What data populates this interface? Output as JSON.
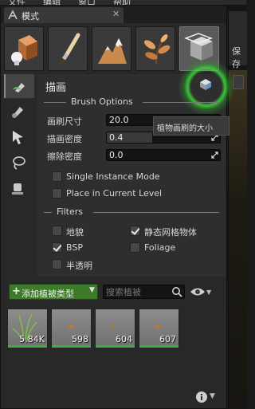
{
  "menubar": {
    "items": [
      "文件",
      "编辑",
      "窗口",
      "帮助"
    ]
  },
  "tab": {
    "label": "模式",
    "close": "✕"
  },
  "modes": [
    {
      "name": "place"
    },
    {
      "name": "paint"
    },
    {
      "name": "landscape"
    },
    {
      "name": "foliage"
    },
    {
      "name": "geometry"
    }
  ],
  "tools": [
    "paint",
    "reapply",
    "select",
    "lasso",
    "fill"
  ],
  "panel": {
    "title": "描画",
    "brush_options": "Brush Options",
    "brush_size_label": "画刷尺寸",
    "brush_size": "20.0",
    "paint_density_label": "描画密度",
    "paint_density": "0.4",
    "paint_density_fraction": 0.4,
    "erase_density_label": "擦除密度",
    "erase_density": "0.0",
    "single_instance": "Single Instance Mode",
    "place_in_level": "Place in Current Level",
    "filters": "Filters",
    "filter_landscape": "地貌",
    "filter_static_mesh": "静态网格物体",
    "filter_bsp": "BSP",
    "filter_foliage": "Foliage",
    "filter_translucent": "半透明",
    "tooltip": "植物画刷的大小"
  },
  "foliage": {
    "add_button": "添加植被类型",
    "search_placeholder": "搜索植被",
    "items": [
      {
        "count": "5.84K"
      },
      {
        "count": "598"
      },
      {
        "count": "604"
      },
      {
        "count": "607"
      }
    ]
  },
  "right_strip": {
    "save": "保存"
  }
}
